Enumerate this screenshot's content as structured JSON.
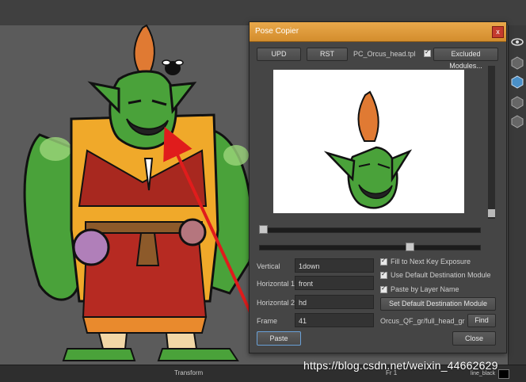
{
  "window": {
    "title": "Pose Copier",
    "close_glyph": "x"
  },
  "toolbar": {
    "upd_label": "UPD",
    "rst_label": "RST",
    "template_name": "PC_Orcus_head.tpl",
    "excluded_modules_label": "Excluded Modules..."
  },
  "fields": {
    "vertical_label": "Vertical",
    "vertical_value": "1down",
    "horizontal1_label": "Horizontal 1",
    "horizontal1_value": "front",
    "horizontal2_label": "Horizontal 2",
    "horizontal2_value": "hd",
    "frame_label": "Frame",
    "frame_value": "41"
  },
  "options": {
    "fill_next_key": "Fill to Next Key Exposure",
    "use_default_dest": "Use Default Destination Module",
    "paste_by_layer": "Paste by Layer Name",
    "set_default_dest_label": "Set Default Destination Module",
    "destination_path": "Orcus_QF_gr/full_head_gr",
    "find_label": "Find"
  },
  "actions": {
    "paste_label": "Paste",
    "close_label": "Close"
  },
  "status_bar": {
    "transform": "Transform",
    "frame": "Fr 1",
    "line_color": "line_black"
  },
  "watermark": "https://blog.csdn.net/weixin_44662629",
  "colors": {
    "title_bar": "#df9a3c",
    "arrow": "#e01c1c",
    "swatch": "#000000"
  }
}
